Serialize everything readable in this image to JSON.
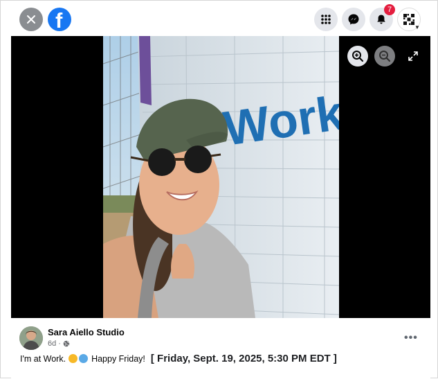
{
  "topbar": {
    "logo_letter": "f",
    "notifications_count": "7",
    "icons": [
      "close-icon",
      "facebook-logo-icon",
      "menu-grid-icon",
      "messenger-icon",
      "bell-icon",
      "account-icon"
    ]
  },
  "media": {
    "wall_text": "Work",
    "controls": [
      "zoom-in-icon",
      "zoom-out-icon",
      "fullscreen-icon"
    ]
  },
  "post": {
    "author": "Sara Aiello Studio",
    "time": "6d",
    "visibility_icon": "globe-icon",
    "caption_text": "I'm at Work.",
    "caption_text2": "Happy Friday!",
    "timestamp": "[ Friday, Sept. 19, 2025, 5:30 PM EDT ]",
    "more_label": "•••"
  },
  "colors": {
    "brand": "#1877f2",
    "badge": "#e41e3f",
    "wall_text": "#1f6fb3"
  }
}
